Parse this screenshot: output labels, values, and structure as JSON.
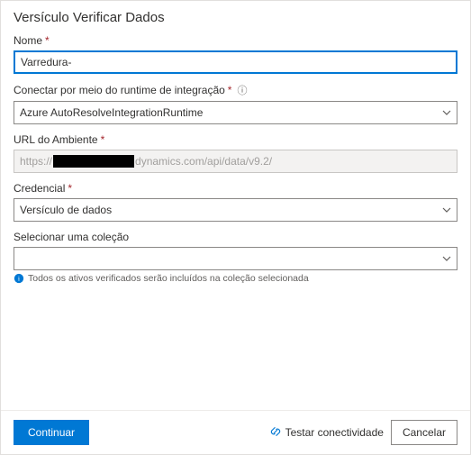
{
  "title": "Versículo Verificar Dados",
  "fields": {
    "name": {
      "label": "Nome",
      "required": "*",
      "value": "Varredura-"
    },
    "runtime": {
      "label": "Conectar por meio do runtime de integração",
      "required": "*",
      "info": "ⓘ",
      "value": "Azure AutoResolveIntegrationRuntime"
    },
    "envUrl": {
      "label": "URL do Ambiente",
      "required": "*",
      "prefix": "https://",
      "suffix": "dynamics.com/api/data/v9.2/"
    },
    "credential": {
      "label": "Credencial",
      "required": "*",
      "value": "Versículo de dados"
    },
    "collection": {
      "label": "Selecionar uma coleção",
      "value": " ",
      "hint": "Todos os ativos verificados serão incluídos na coleção selecionada"
    }
  },
  "footer": {
    "continue": "Continuar",
    "test": "Testar conectividade",
    "cancel": "Cancelar"
  }
}
